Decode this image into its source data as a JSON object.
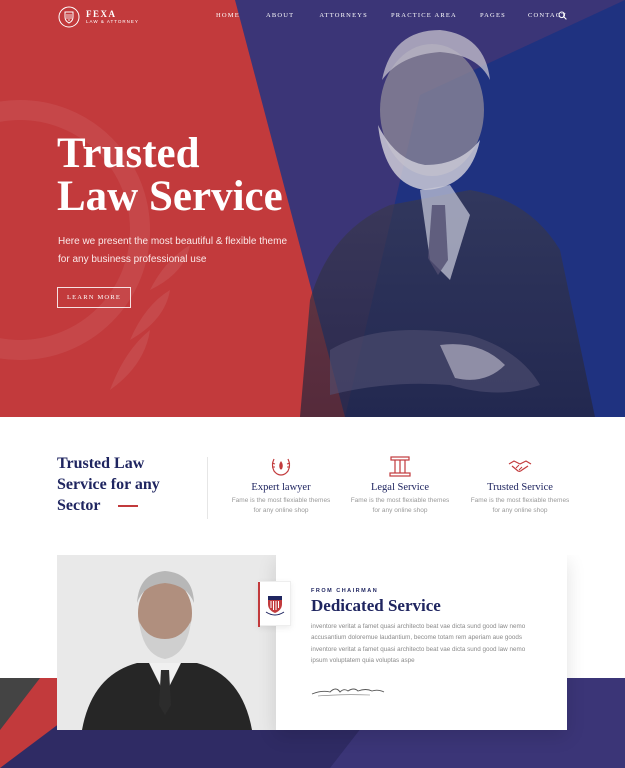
{
  "brand": {
    "name": "FEXA",
    "tagline": "LAW & ATTORNEY"
  },
  "nav": {
    "items": [
      "HOME",
      "ABOUT",
      "ATTORNEYS",
      "PRACTICE AREA",
      "PAGES",
      "CONTACT"
    ],
    "search_icon": "search-icon"
  },
  "hero": {
    "title_line1": "Trusted",
    "title_line2": "Law Service",
    "subtitle_line1": "Here we present the most beautiful & flexible theme",
    "subtitle_line2": "for any business professional use",
    "button_label": "LEARN MORE"
  },
  "features_section": {
    "intro_line1": "Trusted Law",
    "intro_line2": "Service for any",
    "intro_line3": "Sector",
    "items": [
      {
        "icon": "laurel-flame-icon",
        "title": "Expert lawyer",
        "desc_line1": "Fame is the most flexiable themes",
        "desc_line2": "for any online shop"
      },
      {
        "icon": "column-icon",
        "title": "Legal Service",
        "desc_line1": "Fame is the most flexiable themes",
        "desc_line2": "for any online shop"
      },
      {
        "icon": "handshake-icon",
        "title": "Trusted Service",
        "desc_line1": "Fame is the most flexiable themes",
        "desc_line2": "for any online shop"
      }
    ]
  },
  "chairman": {
    "eyebrow": "FROM CHAIRMAN",
    "title": "Dedicated Service",
    "text_lines": [
      "inventore veritat a famet quasi architecto beat vae dicta sund good law nemo",
      "accusantium doloremue laudantium, become totam rem aperiam aue goods",
      "inventore veritat a famet quasi architecto beat vae dicta sund good law nemo",
      "ipsum voluptatem quia voluptas aspe"
    ],
    "badge_icon": "shield-crest-icon"
  },
  "colors": {
    "red": "#c23a3c",
    "navy": "#1f2560",
    "purple": "#3b3577"
  }
}
